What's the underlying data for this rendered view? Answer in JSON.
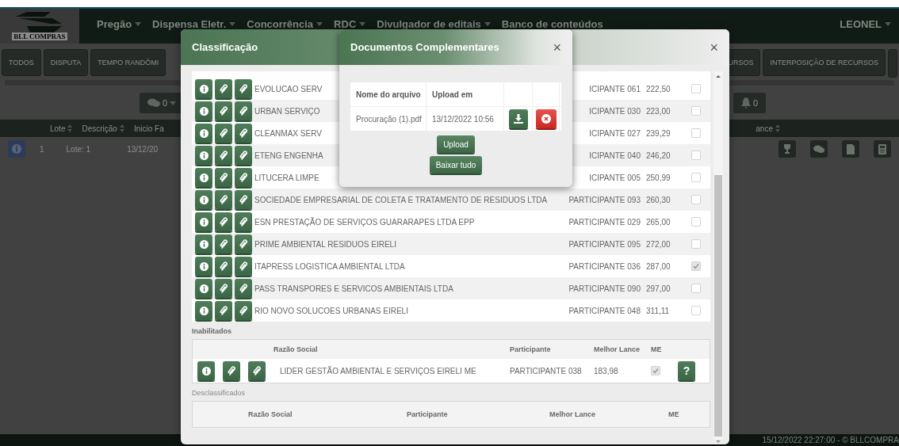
{
  "navbar": {
    "logo_text": "BLL COMPRAS",
    "menu": [
      {
        "label": "Pregão",
        "dropdown": true
      },
      {
        "label": "Dispensa Eletr.",
        "dropdown": true
      },
      {
        "label": "Concorrência",
        "dropdown": true
      },
      {
        "label": "RDC",
        "dropdown": true
      },
      {
        "label": "Divulgador de editais",
        "dropdown": true
      },
      {
        "label": "Banco de conteúdos",
        "dropdown": false
      }
    ],
    "user": {
      "label": "LEONEL",
      "dropdown": true
    }
  },
  "tabs_left": [
    "TODOS",
    "DISPUTA",
    "TEMPO RANDÔMI"
  ],
  "tabs_right": [
    "URSOS",
    "INTERPOSIÇÃO DE RECURSOS"
  ],
  "toolbar": {
    "chat_count": "0",
    "bell_count": "0"
  },
  "lots_table": {
    "columns_left": [
      {
        "label": "Lote",
        "sortable": true
      },
      {
        "label": "Descrição",
        "sortable": true
      },
      {
        "label": "Inicio Fa",
        "sortable": false
      }
    ],
    "column_right": {
      "label": "ance",
      "sortable": true
    },
    "rows": [
      {
        "lote": "1",
        "descricao": "Lote: 1",
        "inicio": "13/12/20"
      }
    ]
  },
  "footer": "15/12/2022 22:27:00 - © BLLCOMPRA",
  "classification_modal": {
    "title": "Classificação",
    "close": "×",
    "rows": [
      {
        "name": "EVOLUCAO SERV",
        "participant": "ICIPANTE 061",
        "bid": "222,50",
        "me": false
      },
      {
        "name": "URBAN SERVIÇO",
        "participant": "ICIPANTE 030",
        "bid": "223,00",
        "me": false
      },
      {
        "name": "CLEANMAX SERV",
        "participant": "ICIPANTE 027",
        "bid": "239,29",
        "me": false
      },
      {
        "name": "ETENG ENGENHA",
        "participant": "ICIPANTE 040",
        "bid": "246,20",
        "me": false
      },
      {
        "name": "LITUCERA LIMPE",
        "participant": "ICIPANTE 005",
        "bid": "250,99",
        "me": false
      },
      {
        "name": "SOCIEDADE EMPRESARIAL DE COLETA E TRATAMENTO DE RESIDUOS LTDA",
        "participant": "PARTICIPANTE 093",
        "bid": "260,30",
        "me": false
      },
      {
        "name": "ESN PRESTAÇÃO DE SERVIÇOS GUARARAPES LTDA EPP",
        "participant": "PARTICIPANTE 029",
        "bid": "265,00",
        "me": false
      },
      {
        "name": "PRIME AMBIENTAL RESIDUOS EIRELI",
        "participant": "PARTICIPANTE 095",
        "bid": "272,00",
        "me": false
      },
      {
        "name": "ITAPRESS LOGISTICA AMBIENTAL LTDA",
        "participant": "PARTICIPANTE 036",
        "bid": "287,00",
        "me": true
      },
      {
        "name": "PASS TRANSPORES E SERVICOS AMBIENTAIS LTDA",
        "participant": "PARTICIPANTE 090",
        "bid": "297,00",
        "me": false
      },
      {
        "name": "RIO NOVO SOLUCOES URBANAS EIRELI",
        "participant": "PARTICIPANTE 048",
        "bid": "311,11",
        "me": false
      }
    ],
    "inabilitados": {
      "label": "Inabilitados",
      "columns": [
        "Razão Social",
        "Participante",
        "Melhor Lance",
        "ME"
      ],
      "rows": [
        {
          "name": "LIDER GESTÃO AMBIENTAL E SERVIÇOS EIRELI ME",
          "participant": "PARTICIPANTE 038",
          "bid": "183,98",
          "me": true,
          "help": "?"
        }
      ]
    },
    "desclassificados": {
      "label": "Desclassificados",
      "columns": [
        "Razão Social",
        "Participante",
        "Melhor Lance",
        "ME"
      ]
    }
  },
  "documents_modal": {
    "title": "Documentos Complementares",
    "close": "×",
    "columns": [
      "Nome do arquivo",
      "Upload em"
    ],
    "files": [
      {
        "name": "Procuração (1).pdf",
        "uploaded": "13/12/2022 10:56"
      }
    ],
    "buttons": [
      "Upload",
      "Baixar tudo"
    ]
  }
}
